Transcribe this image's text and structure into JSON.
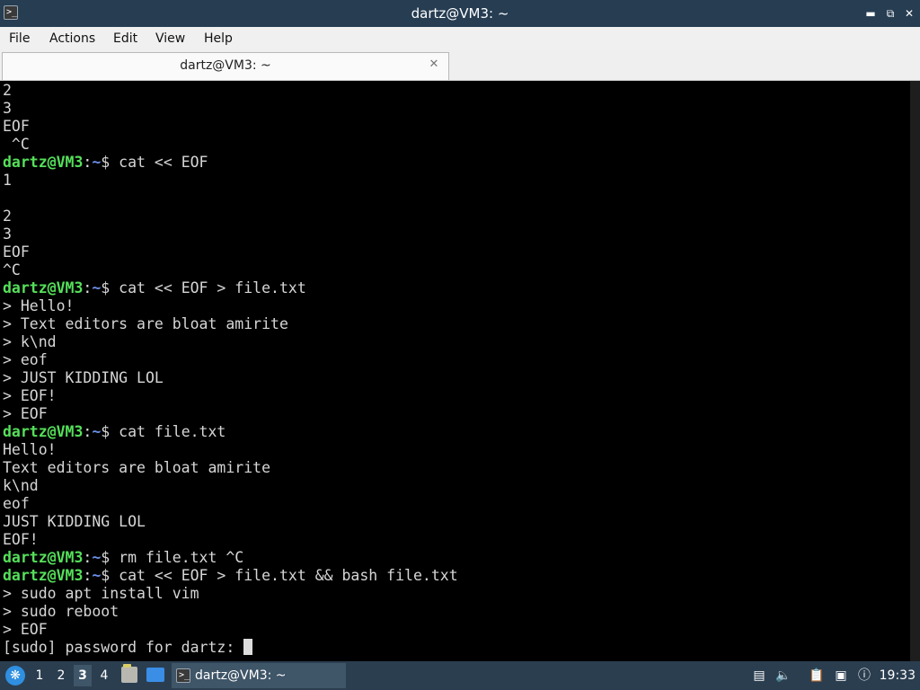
{
  "window": {
    "title": "dartz@VM3: ~",
    "app_icon": "terminal-icon",
    "controls": [
      "minimize-icon",
      "restore-icon",
      "close-icon"
    ]
  },
  "menubar": {
    "items": [
      "File",
      "Actions",
      "Edit",
      "View",
      "Help"
    ]
  },
  "tabs": [
    {
      "label": "dartz@VM3: ~",
      "close_icon": "close-tab-icon"
    }
  ],
  "prompt": {
    "user": "dartz@VM3",
    "colon": ":",
    "path": "~",
    "symbol": "$ "
  },
  "terminal_lines": [
    {
      "text": "2"
    },
    {
      "text": "3"
    },
    {
      "text": "EOF"
    },
    {
      "text": " ^C"
    },
    {
      "cmd": "cat << EOF"
    },
    {
      "text": "1"
    },
    {
      "text": ""
    },
    {
      "text": "2"
    },
    {
      "text": "3"
    },
    {
      "text": "EOF"
    },
    {
      "text": "^C"
    },
    {
      "cmd": "cat << EOF > file.txt"
    },
    {
      "text": "> Hello!"
    },
    {
      "text": "> Text editors are bloat amirite"
    },
    {
      "text": "> k\\nd"
    },
    {
      "text": "> eof"
    },
    {
      "text": "> JUST KIDDING LOL"
    },
    {
      "text": "> EOF!"
    },
    {
      "text": "> EOF"
    },
    {
      "cmd": "cat file.txt"
    },
    {
      "text": "Hello!"
    },
    {
      "text": "Text editors are bloat amirite"
    },
    {
      "text": "k\\nd"
    },
    {
      "text": "eof"
    },
    {
      "text": "JUST KIDDING LOL"
    },
    {
      "text": "EOF!"
    },
    {
      "cmd": "rm file.txt ^C"
    },
    {
      "cmd": "cat << EOF > file.txt && bash file.txt"
    },
    {
      "text": "> sudo apt install vim"
    },
    {
      "text": "> sudo reboot"
    },
    {
      "text": "> EOF"
    },
    {
      "text": "[sudo] password for dartz: ",
      "cursor": true
    }
  ],
  "taskbar": {
    "menu_icon": "app-menu-icon",
    "workspaces": [
      "1",
      "2",
      "3",
      "4"
    ],
    "active_workspace": "3",
    "window_button": "dartz@VM3: ~",
    "tray_icons": [
      "update-icon",
      "volume-icon",
      "clipboard-icon",
      "network-icon"
    ],
    "clock": "19:33"
  },
  "colors": {
    "titlebar": "#263d52",
    "taskbar": "#2b3e50",
    "prompt_user": "#55e05a",
    "prompt_path": "#6b8fe8",
    "terminal_bg": "#000000",
    "terminal_text": "#d6d6d6"
  }
}
